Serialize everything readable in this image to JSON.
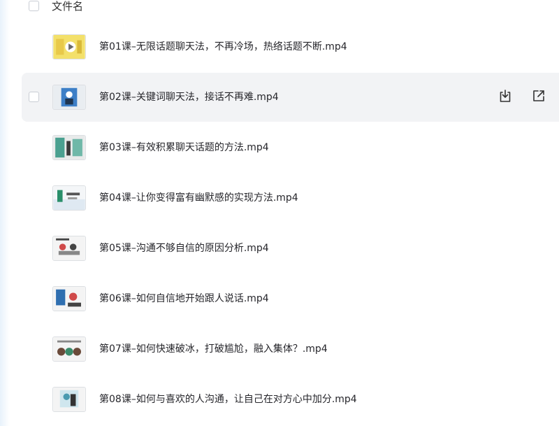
{
  "header": {
    "column_title": "文件名"
  },
  "files": [
    {
      "name": "第01课–无限话题聊天法，不再冷场，热络话题不断.mp4",
      "thumb_icon": "video-thumbnail-icon",
      "thumb_colors": [
        "#f3e06a",
        "#ffffff",
        "#6a6a6a"
      ]
    },
    {
      "name": "第02课–关键词聊天法，接话不再难.mp4",
      "thumb_icon": "video-thumbnail-icon",
      "thumb_colors": [
        "#3d7fc7",
        "#ffffff",
        "#1f3550"
      ]
    },
    {
      "name": "第03课–有效积累聊天话题的方法.mp4",
      "thumb_icon": "video-thumbnail-icon",
      "thumb_colors": [
        "#4aa090",
        "#e8eaea",
        "#3a3a3a"
      ]
    },
    {
      "name": "第04课–让你变得富有幽默感的实现方法.mp4",
      "thumb_icon": "video-thumbnail-icon",
      "thumb_colors": [
        "#dfe9f2",
        "#2a8f6a",
        "#555555"
      ]
    },
    {
      "name": "第05课–沟通不够自信的原因分析.mp4",
      "thumb_icon": "video-thumbnail-icon",
      "thumb_colors": [
        "#f4f4f4",
        "#d04a4a",
        "#444444"
      ]
    },
    {
      "name": "第06课–如何自信地开始跟人说话.mp4",
      "thumb_icon": "video-thumbnail-icon",
      "thumb_colors": [
        "#f4f4f4",
        "#d04a4a",
        "#2f6fb0"
      ]
    },
    {
      "name": "第07课–如何快速破冰，打破尴尬，融入集体？.mp4",
      "thumb_icon": "video-thumbnail-icon",
      "thumb_colors": [
        "#f4f4f4",
        "#6a4a3a",
        "#3a8a6a"
      ]
    },
    {
      "name": "第08课–如何与喜欢的人沟通，让自己在对方心中加分.mp4",
      "thumb_icon": "video-thumbnail-icon",
      "thumb_colors": [
        "#f4f4f4",
        "#4a9ab0",
        "#333333"
      ]
    }
  ],
  "hovered_row_index": 1,
  "row_actions": [
    {
      "icon": "download-icon"
    },
    {
      "icon": "share-external-icon"
    }
  ],
  "colors": {
    "hover_background": "#f2f3f5",
    "text": "#26262b",
    "checkbox_border": "#c9cdd4"
  }
}
